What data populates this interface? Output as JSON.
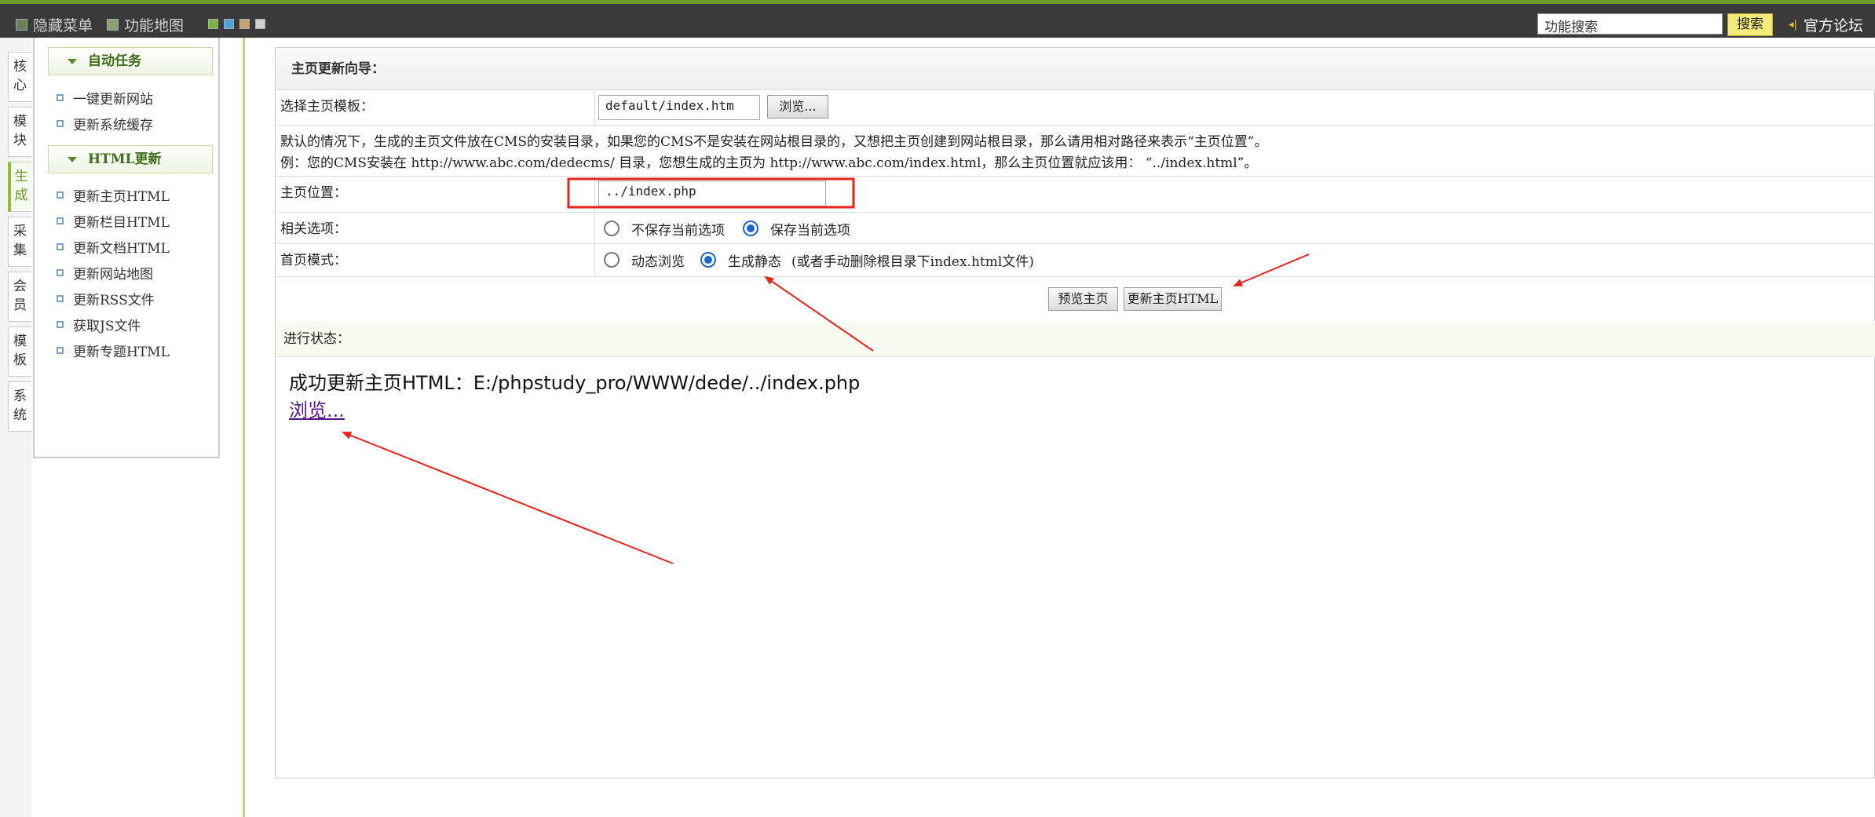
{
  "topbar": {
    "hide_menu": "隐藏菜单",
    "site_map": "功能地图",
    "swatch_colors": [
      "#7cb342",
      "#4fa3e0",
      "#c8a070",
      "#d0d0d0"
    ],
    "search_value": "功能搜索",
    "search_button": "搜索",
    "forum_link": "官方论坛"
  },
  "left_tabs": [
    {
      "label": "核心",
      "active": false
    },
    {
      "label": "模块",
      "active": false
    },
    {
      "label": "生成",
      "active": true
    },
    {
      "label": "采集",
      "active": false
    },
    {
      "label": "会员",
      "active": false
    },
    {
      "label": "模板",
      "active": false
    },
    {
      "label": "系统",
      "active": false
    }
  ],
  "sidebar": {
    "auto_tasks": {
      "title": "自动任务",
      "items": [
        "一键更新网站",
        "更新系统缓存"
      ]
    },
    "html_update": {
      "title": "HTML更新",
      "items": [
        "更新主页HTML",
        "更新栏目HTML",
        "更新文档HTML",
        "更新网站地图",
        "更新RSS文件",
        "获取JS文件",
        "更新专题HTML"
      ]
    }
  },
  "panel": {
    "title": "主页更新向导：",
    "template_label": "选择主页模板：",
    "template_value": "default/index.htm",
    "browse_button": "浏览...",
    "note_line1": "默认的情况下，生成的主页文件放在CMS的安装目录，如果您的CMS不是安装在网站根目录的，又想把主页创建到网站根目录，那么请用相对路径来表示“主页位置”。",
    "note_line2": "例：您的CMS安装在 http://www.abc.com/dedecms/ 目录，您想生成的主页为 http://www.abc.com/index.html，那么主页位置就应该用： “../index.html”。",
    "location_label": "主页位置：",
    "location_value": "../index.php",
    "options_label": "相关选项：",
    "option_no_save": "不保存当前选项",
    "option_save": "保存当前选项",
    "option_selected": "保存当前选项",
    "mode_label": "首页模式：",
    "mode_dynamic": "动态浏览",
    "mode_static": "生成静态",
    "mode_static_hint": "(或者手动删除根目录下index.html文件)",
    "mode_selected": "生成静态",
    "preview_button": "预览主页",
    "update_button": "更新主页HTML",
    "status_label": "进行状态：",
    "result_text": "成功更新主页HTML：E:/phpstudy_pro/WWW/dede/../index.php",
    "result_link": "浏览..."
  },
  "annotation_color": "#e8231b"
}
